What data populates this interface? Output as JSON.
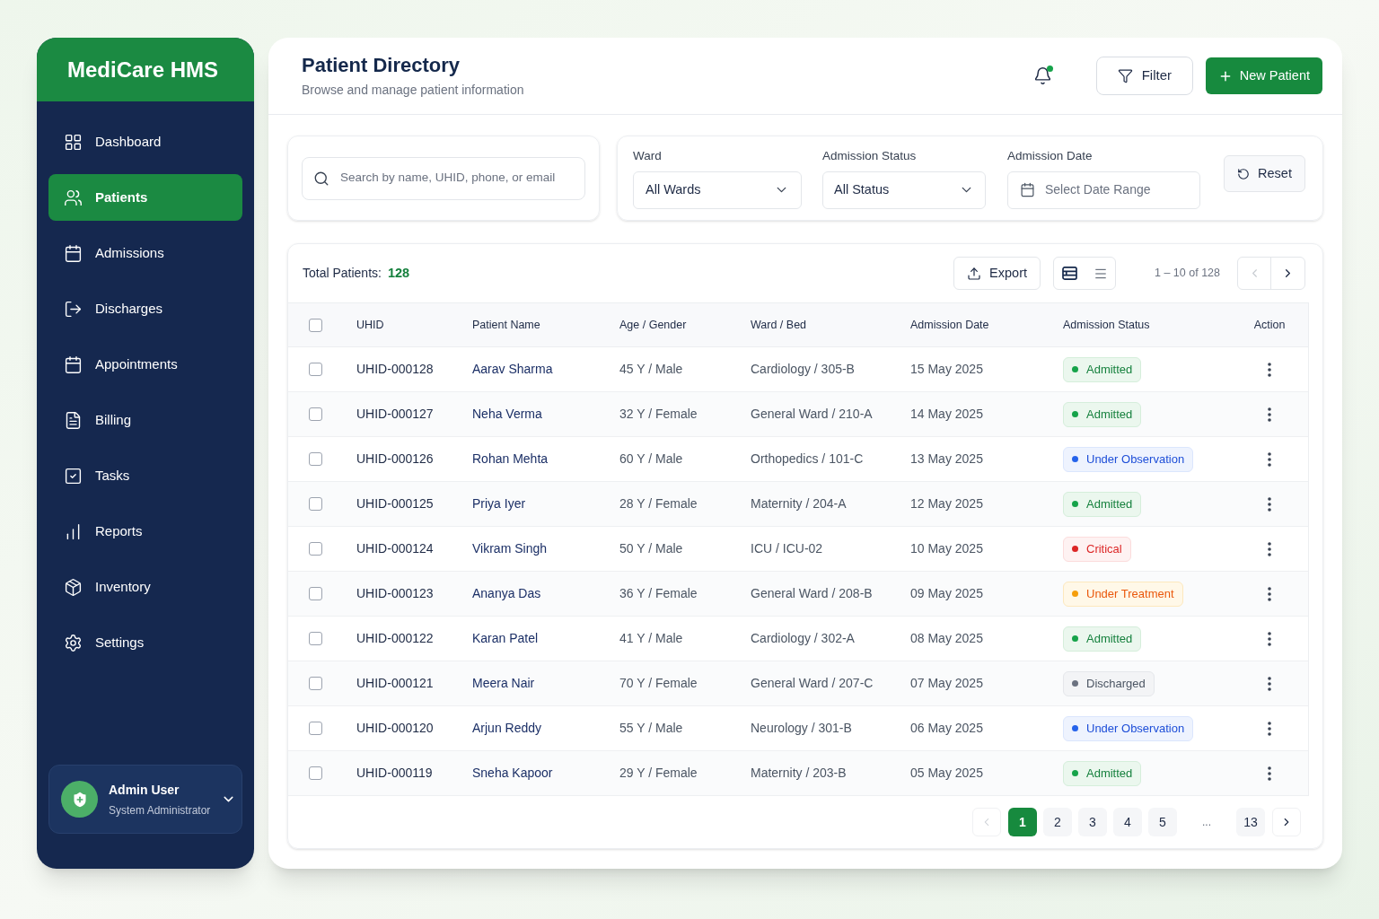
{
  "sidebar": {
    "brand": "MediCare HMS",
    "items": [
      {
        "label": "Dashboard",
        "selected": false
      },
      {
        "label": "Patients",
        "selected": true
      },
      {
        "label": "Admissions",
        "selected": false
      },
      {
        "label": "Discharges",
        "selected": false
      },
      {
        "label": "Appointments",
        "selected": false
      },
      {
        "label": "Billing",
        "selected": false
      },
      {
        "label": "Tasks",
        "selected": false
      },
      {
        "label": "Reports",
        "selected": false
      },
      {
        "label": "Inventory",
        "selected": false
      },
      {
        "label": "Settings",
        "selected": false
      }
    ],
    "user": {
      "name": "Admin User",
      "role": "System Administrator"
    }
  },
  "header": {
    "title": "Patient Directory",
    "subtitle": "Browse and manage patient information",
    "notifications": {
      "unread": true
    },
    "filter_button": "Filter",
    "new_button": "New Patient"
  },
  "filters": {
    "search": {
      "placeholder": "Search by name, UHID, phone, or email"
    },
    "ward": {
      "label": "Ward",
      "value": "All Wards"
    },
    "status": {
      "label": "Admission Status",
      "value": "All Status"
    },
    "date": {
      "label": "Admission Date",
      "placeholder": "Select Date Range"
    },
    "reset_button": "Reset"
  },
  "table": {
    "total_label": "Total Patients:",
    "total": "128",
    "export_button": "Export",
    "view_modes": [
      {
        "kind": "table",
        "selected": true
      },
      {
        "kind": "list",
        "selected": false
      }
    ],
    "range": "1 – 10 of 128",
    "prev": {
      "disabled": true
    },
    "next": {
      "disabled": false
    },
    "select_all": {
      "checked": false
    },
    "columns": [
      "UHID",
      "Patient Name",
      "Age / Gender",
      "Ward / Bed",
      "Admission Date",
      "Admission Status",
      "Action"
    ],
    "rows": [
      {
        "checked": false,
        "uhid": "UHID-000128",
        "name": "Aarav Sharma",
        "age_gender": "45 Y / Male",
        "ward_bed": "Cardiology / 305-B",
        "admission_date": "15 May 2025",
        "status": {
          "label": "Admitted",
          "kind": "admitted",
          "color": "#16a34a"
        }
      },
      {
        "checked": false,
        "uhid": "UHID-000127",
        "name": "Neha Verma",
        "age_gender": "32 Y / Female",
        "ward_bed": "General Ward / 210-A",
        "admission_date": "14 May 2025",
        "status": {
          "label": "Admitted",
          "kind": "admitted",
          "color": "#16a34a"
        }
      },
      {
        "checked": false,
        "uhid": "UHID-000126",
        "name": "Rohan Mehta",
        "age_gender": "60 Y / Male",
        "ward_bed": "Orthopedics / 101-C",
        "admission_date": "13 May 2025",
        "status": {
          "label": "Under Observation",
          "kind": "observation",
          "color": "#2563eb"
        }
      },
      {
        "checked": false,
        "uhid": "UHID-000125",
        "name": "Priya Iyer",
        "age_gender": "28 Y / Female",
        "ward_bed": "Maternity / 204-A",
        "admission_date": "12 May 2025",
        "status": {
          "label": "Admitted",
          "kind": "admitted",
          "color": "#16a34a"
        }
      },
      {
        "checked": false,
        "uhid": "UHID-000124",
        "name": "Vikram Singh",
        "age_gender": "50 Y / Male",
        "ward_bed": "ICU / ICU-02",
        "admission_date": "10 May 2025",
        "status": {
          "label": "Critical",
          "kind": "critical",
          "color": "#dc2626"
        }
      },
      {
        "checked": false,
        "uhid": "UHID-000123",
        "name": "Ananya Das",
        "age_gender": "36 Y / Female",
        "ward_bed": "General Ward / 208-B",
        "admission_date": "09 May 2025",
        "status": {
          "label": "Under Treatment",
          "kind": "treatment",
          "color": "#f59e0b"
        }
      },
      {
        "checked": false,
        "uhid": "UHID-000122",
        "name": "Karan Patel",
        "age_gender": "41 Y / Male",
        "ward_bed": "Cardiology / 302-A",
        "admission_date": "08 May 2025",
        "status": {
          "label": "Admitted",
          "kind": "admitted",
          "color": "#16a34a"
        }
      },
      {
        "checked": false,
        "uhid": "UHID-000121",
        "name": "Meera Nair",
        "age_gender": "70 Y / Female",
        "ward_bed": "General Ward / 207-C",
        "admission_date": "07 May 2025",
        "status": {
          "label": "Discharged",
          "kind": "discharged",
          "color": "#6b7280"
        }
      },
      {
        "checked": false,
        "uhid": "UHID-000120",
        "name": "Arjun Reddy",
        "age_gender": "55 Y / Male",
        "ward_bed": "Neurology / 301-B",
        "admission_date": "06 May 2025",
        "status": {
          "label": "Under Observation",
          "kind": "observation",
          "color": "#2563eb"
        }
      },
      {
        "checked": false,
        "uhid": "UHID-000119",
        "name": "Sneha Kapoor",
        "age_gender": "29 Y / Female",
        "ward_bed": "Maternity / 203-B",
        "admission_date": "05 May 2025",
        "status": {
          "label": "Admitted",
          "kind": "admitted",
          "color": "#16a34a"
        }
      }
    ]
  },
  "pagination": {
    "prev": {
      "disabled": true
    },
    "pages": [
      {
        "label": "1",
        "kind": "page",
        "selected": true
      },
      {
        "label": "2",
        "kind": "page",
        "selected": false
      },
      {
        "label": "3",
        "kind": "page",
        "selected": false
      },
      {
        "label": "4",
        "kind": "page",
        "selected": false
      },
      {
        "label": "5",
        "kind": "page",
        "selected": false
      },
      {
        "label": "...",
        "kind": "gap",
        "selected": false
      },
      {
        "label": "13",
        "kind": "page",
        "selected": false
      }
    ],
    "next": {
      "disabled": false
    }
  }
}
